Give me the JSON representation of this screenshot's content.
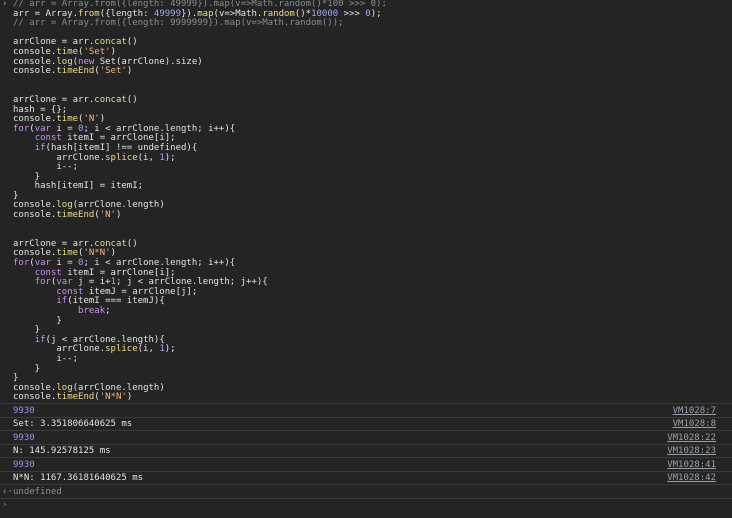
{
  "input": {
    "prompt_glyph": "›",
    "lines": [
      [
        {
          "t": "comment",
          "s": "// arr = Array.from({length: 49999}).map(v=>Math.random()*100 >>> 0);"
        }
      ],
      [
        {
          "t": "plain",
          "s": "arr = Array."
        },
        {
          "t": "fn",
          "s": "from"
        },
        {
          "t": "plain",
          "s": "({length: "
        },
        {
          "t": "num",
          "s": "49999"
        },
        {
          "t": "plain",
          "s": "})."
        },
        {
          "t": "fn",
          "s": "map"
        },
        {
          "t": "plain",
          "s": "(v=>Math."
        },
        {
          "t": "fn",
          "s": "random"
        },
        {
          "t": "plain",
          "s": "()*"
        },
        {
          "t": "num",
          "s": "10000"
        },
        {
          "t": "plain",
          "s": " >>> "
        },
        {
          "t": "num",
          "s": "0"
        },
        {
          "t": "plain",
          "s": ");"
        }
      ],
      [
        {
          "t": "comment",
          "s": "// arr = Array.from({length: 9999999}).map(v=>Math.random());"
        }
      ],
      [],
      [
        {
          "t": "plain",
          "s": "arrClone = arr."
        },
        {
          "t": "fn",
          "s": "concat"
        },
        {
          "t": "plain",
          "s": "()"
        }
      ],
      [
        {
          "t": "plain",
          "s": "console."
        },
        {
          "t": "fn",
          "s": "time"
        },
        {
          "t": "plain",
          "s": "("
        },
        {
          "t": "string",
          "s": "'Set'"
        },
        {
          "t": "plain",
          "s": ")"
        }
      ],
      [
        {
          "t": "plain",
          "s": "console."
        },
        {
          "t": "fn",
          "s": "log"
        },
        {
          "t": "plain",
          "s": "("
        },
        {
          "t": "keyword",
          "s": "new"
        },
        {
          "t": "plain",
          "s": " Set(arrClone).size)"
        }
      ],
      [
        {
          "t": "plain",
          "s": "console."
        },
        {
          "t": "fn",
          "s": "timeEnd"
        },
        {
          "t": "plain",
          "s": "("
        },
        {
          "t": "string",
          "s": "'Set'"
        },
        {
          "t": "plain",
          "s": ")"
        }
      ],
      [],
      [],
      [
        {
          "t": "plain",
          "s": "arrClone = arr."
        },
        {
          "t": "fn",
          "s": "concat"
        },
        {
          "t": "plain",
          "s": "()"
        }
      ],
      [
        {
          "t": "plain",
          "s": "hash = {};"
        }
      ],
      [
        {
          "t": "plain",
          "s": "console."
        },
        {
          "t": "fn",
          "s": "time"
        },
        {
          "t": "plain",
          "s": "("
        },
        {
          "t": "string",
          "s": "'N'"
        },
        {
          "t": "plain",
          "s": ")"
        }
      ],
      [
        {
          "t": "keyword",
          "s": "for"
        },
        {
          "t": "plain",
          "s": "("
        },
        {
          "t": "keyword",
          "s": "var"
        },
        {
          "t": "plain",
          "s": " i = "
        },
        {
          "t": "num",
          "s": "0"
        },
        {
          "t": "plain",
          "s": "; i < arrClone.length; i++){"
        }
      ],
      [
        {
          "t": "plain",
          "s": "    "
        },
        {
          "t": "keyword",
          "s": "const"
        },
        {
          "t": "plain",
          "s": " itemI = arrClone[i];"
        }
      ],
      [
        {
          "t": "plain",
          "s": "    "
        },
        {
          "t": "keyword",
          "s": "if"
        },
        {
          "t": "plain",
          "s": "(hash[itemI] !== undefined){"
        }
      ],
      [
        {
          "t": "plain",
          "s": "        arrClone."
        },
        {
          "t": "fn",
          "s": "splice"
        },
        {
          "t": "plain",
          "s": "(i, "
        },
        {
          "t": "num",
          "s": "1"
        },
        {
          "t": "plain",
          "s": ");"
        }
      ],
      [
        {
          "t": "plain",
          "s": "        i--;"
        }
      ],
      [
        {
          "t": "plain",
          "s": "    }"
        }
      ],
      [
        {
          "t": "plain",
          "s": "    hash[itemI] = itemI;"
        }
      ],
      [
        {
          "t": "plain",
          "s": "}"
        }
      ],
      [
        {
          "t": "plain",
          "s": "console."
        },
        {
          "t": "fn",
          "s": "log"
        },
        {
          "t": "plain",
          "s": "(arrClone.length)"
        }
      ],
      [
        {
          "t": "plain",
          "s": "console."
        },
        {
          "t": "fn",
          "s": "timeEnd"
        },
        {
          "t": "plain",
          "s": "("
        },
        {
          "t": "string",
          "s": "'N'"
        },
        {
          "t": "plain",
          "s": ")"
        }
      ],
      [],
      [],
      [
        {
          "t": "plain",
          "s": "arrClone = arr."
        },
        {
          "t": "fn",
          "s": "concat"
        },
        {
          "t": "plain",
          "s": "()"
        }
      ],
      [
        {
          "t": "plain",
          "s": "console."
        },
        {
          "t": "fn",
          "s": "time"
        },
        {
          "t": "plain",
          "s": "("
        },
        {
          "t": "string",
          "s": "'N*N'"
        },
        {
          "t": "plain",
          "s": ")"
        }
      ],
      [
        {
          "t": "keyword",
          "s": "for"
        },
        {
          "t": "plain",
          "s": "("
        },
        {
          "t": "keyword",
          "s": "var"
        },
        {
          "t": "plain",
          "s": " i = "
        },
        {
          "t": "num",
          "s": "0"
        },
        {
          "t": "plain",
          "s": "; i < arrClone.length; i++){"
        }
      ],
      [
        {
          "t": "plain",
          "s": "    "
        },
        {
          "t": "keyword",
          "s": "const"
        },
        {
          "t": "plain",
          "s": " itemI = arrClone[i];"
        }
      ],
      [
        {
          "t": "plain",
          "s": "    "
        },
        {
          "t": "keyword",
          "s": "for"
        },
        {
          "t": "plain",
          "s": "("
        },
        {
          "t": "keyword",
          "s": "var"
        },
        {
          "t": "plain",
          "s": " j = i+"
        },
        {
          "t": "num",
          "s": "1"
        },
        {
          "t": "plain",
          "s": "; j < arrClone.length; j++){"
        }
      ],
      [
        {
          "t": "plain",
          "s": "        "
        },
        {
          "t": "keyword",
          "s": "const"
        },
        {
          "t": "plain",
          "s": " itemJ = arrClone[j];"
        }
      ],
      [
        {
          "t": "plain",
          "s": "        "
        },
        {
          "t": "keyword",
          "s": "if"
        },
        {
          "t": "plain",
          "s": "(itemI === itemJ){"
        }
      ],
      [
        {
          "t": "plain",
          "s": "            "
        },
        {
          "t": "keyword",
          "s": "break"
        },
        {
          "t": "plain",
          "s": ";"
        }
      ],
      [
        {
          "t": "plain",
          "s": "        }"
        }
      ],
      [
        {
          "t": "plain",
          "s": "    }"
        }
      ],
      [
        {
          "t": "plain",
          "s": "    "
        },
        {
          "t": "keyword",
          "s": "if"
        },
        {
          "t": "plain",
          "s": "(j < arrClone.length){"
        }
      ],
      [
        {
          "t": "plain",
          "s": "        arrClone."
        },
        {
          "t": "fn",
          "s": "splice"
        },
        {
          "t": "plain",
          "s": "(i, "
        },
        {
          "t": "num",
          "s": "1"
        },
        {
          "t": "plain",
          "s": ");"
        }
      ],
      [
        {
          "t": "plain",
          "s": "        i--;"
        }
      ],
      [
        {
          "t": "plain",
          "s": "    }"
        }
      ],
      [
        {
          "t": "plain",
          "s": "}"
        }
      ],
      [
        {
          "t": "plain",
          "s": "console."
        },
        {
          "t": "fn",
          "s": "log"
        },
        {
          "t": "plain",
          "s": "(arrClone.length)"
        }
      ],
      [
        {
          "t": "plain",
          "s": "console."
        },
        {
          "t": "fn",
          "s": "timeEnd"
        },
        {
          "t": "plain",
          "s": "("
        },
        {
          "t": "string",
          "s": "'N*N'"
        },
        {
          "t": "plain",
          "s": ")"
        }
      ]
    ]
  },
  "outputs": [
    {
      "text": "9930",
      "kind": "number",
      "source": "VM1028:7"
    },
    {
      "text": "Set: 3.351806640625 ms",
      "kind": "string",
      "source": "VM1028:8"
    },
    {
      "text": "9930",
      "kind": "number",
      "source": "VM1028:22"
    },
    {
      "text": "N: 145.92578125 ms",
      "kind": "string",
      "source": "VM1028:23"
    },
    {
      "text": "9930",
      "kind": "number",
      "source": "VM1028:41"
    },
    {
      "text": "N*N: 1167.36181640625 ms",
      "kind": "string",
      "source": "VM1028:42"
    }
  ],
  "result": {
    "glyph": "‹·",
    "text": "undefined"
  },
  "prompt": {
    "glyph": "›",
    "value": ""
  },
  "colors": {
    "background": "#242424",
    "comment": "#8b8b8b",
    "keyword": "#c792ea",
    "string": "#f2b482",
    "function": "#e9dd8c",
    "number": "#a1a8f0",
    "output_number": "#9d8ff0",
    "prompt_accent": "#3d8ef0"
  }
}
